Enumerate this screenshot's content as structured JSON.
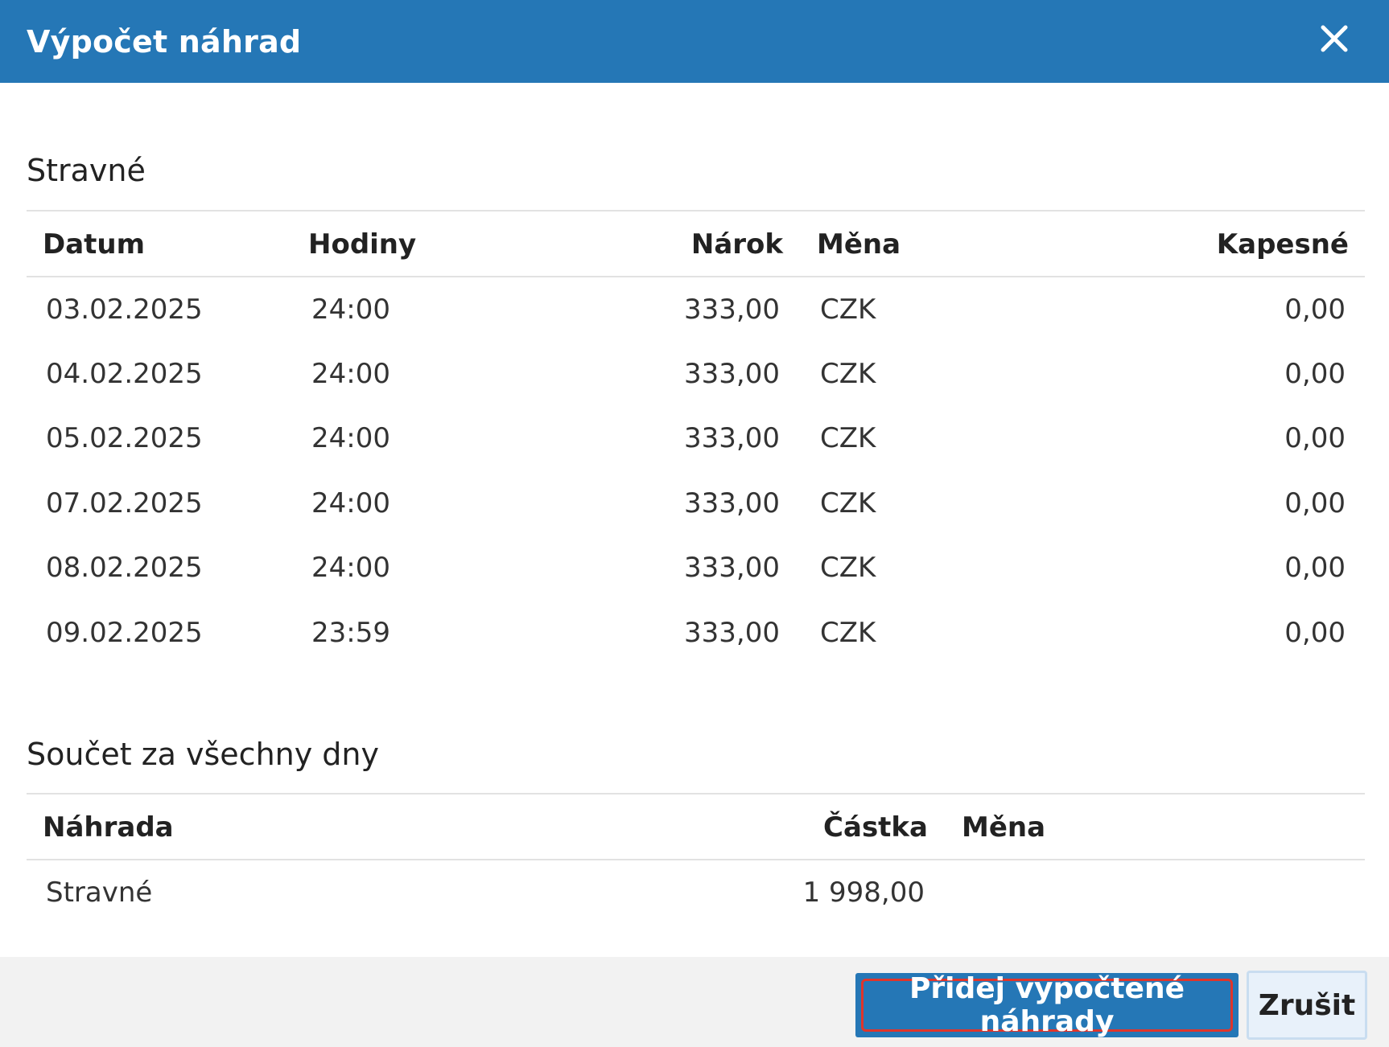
{
  "dialog": {
    "title": "Výpočet náhrad",
    "close_icon": "close-icon"
  },
  "meal_section": {
    "title": "Stravné",
    "columns": {
      "date": "Datum",
      "hours": "Hodiny",
      "entitlement": "Nárok",
      "currency": "Měna",
      "pocket_money": "Kapesné"
    },
    "rows": [
      {
        "date": "03.02.2025",
        "hours": "24:00",
        "entitlement": "333,00",
        "currency": "CZK",
        "pocket_money": "0,00"
      },
      {
        "date": "04.02.2025",
        "hours": "24:00",
        "entitlement": "333,00",
        "currency": "CZK",
        "pocket_money": "0,00"
      },
      {
        "date": "05.02.2025",
        "hours": "24:00",
        "entitlement": "333,00",
        "currency": "CZK",
        "pocket_money": "0,00"
      },
      {
        "date": "07.02.2025",
        "hours": "24:00",
        "entitlement": "333,00",
        "currency": "CZK",
        "pocket_money": "0,00"
      },
      {
        "date": "08.02.2025",
        "hours": "24:00",
        "entitlement": "333,00",
        "currency": "CZK",
        "pocket_money": "0,00"
      },
      {
        "date": "09.02.2025",
        "hours": "23:59",
        "entitlement": "333,00",
        "currency": "CZK",
        "pocket_money": "0,00"
      }
    ]
  },
  "sum_section": {
    "title": "Součet za všechny dny",
    "columns": {
      "compensation": "Náhrada",
      "amount": "Částka",
      "currency": "Měna"
    },
    "rows": [
      {
        "compensation": "Stravné",
        "amount": "1 998,00",
        "currency": ""
      }
    ]
  },
  "footer": {
    "add_label": "Přidej vypočtené náhrady",
    "cancel_label": "Zrušit"
  },
  "colors": {
    "header_bg": "#2577b6",
    "primary_button": "#2577b6",
    "focus_ring": "#e0352b",
    "footer_bg": "#f2f2f2"
  }
}
